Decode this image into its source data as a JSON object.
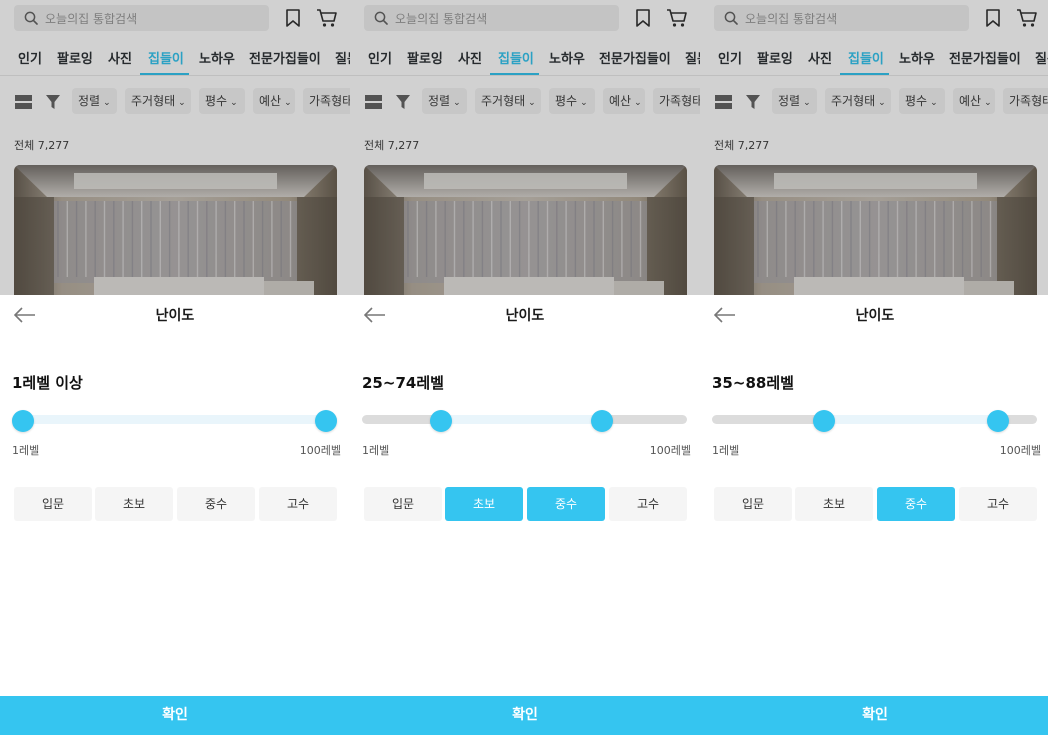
{
  "header": {
    "search_placeholder": "오늘의집 통합검색"
  },
  "categories": [
    "인기",
    "팔로잉",
    "사진",
    "집들이",
    "노하우",
    "전문가집들이",
    "질문"
  ],
  "filters": [
    "정렬",
    "주거형태",
    "평수",
    "예산",
    "가족형태"
  ],
  "total_label": "전체 7,277",
  "sheet": {
    "title": "난이도",
    "min_label": "1레벨",
    "max_label": "100레벨",
    "level_buttons": [
      "입문",
      "초보",
      "중수",
      "고수"
    ],
    "confirm_label": "확인"
  },
  "panels": [
    {
      "range_text": "1레벨 이상",
      "min_level": 1,
      "max_level": 100,
      "selected_buttons": []
    },
    {
      "range_text": "25~74레벨",
      "min_level": 25,
      "max_level": 74,
      "selected_buttons": [
        "초보",
        "중수"
      ]
    },
    {
      "range_text": "35~88레벨",
      "min_level": 35,
      "max_level": 88,
      "selected_buttons": [
        "중수"
      ]
    }
  ],
  "colors": {
    "accent": "#35c5f0",
    "active_category": "#35c5f0"
  },
  "icons": [
    "search-icon",
    "bookmark-icon",
    "cart-icon",
    "grid-view-icon",
    "filter-icon",
    "chevron-down-icon",
    "back-arrow-icon"
  ]
}
